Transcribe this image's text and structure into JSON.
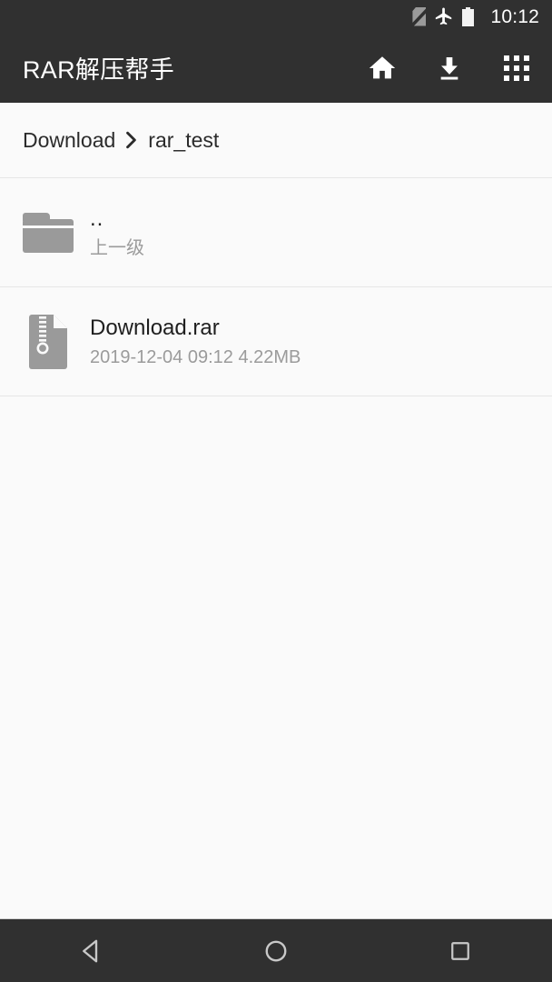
{
  "statusbar": {
    "time": "10:12",
    "icons": [
      "no-sim-icon",
      "airplane-mode-icon",
      "battery-icon"
    ]
  },
  "toolbar": {
    "title": "RAR解压帮手",
    "actions": [
      {
        "name": "home-icon",
        "label": "Home"
      },
      {
        "name": "download-icon",
        "label": "Download"
      },
      {
        "name": "apps-grid-icon",
        "label": "Apps"
      }
    ]
  },
  "breadcrumb": {
    "root": "Download",
    "separator": "chevron-right-icon",
    "current": "rar_test"
  },
  "list": {
    "items": [
      {
        "icon": "folder-icon",
        "title": "..",
        "subtitle": "上一级"
      },
      {
        "icon": "archive-file-icon",
        "title": "Download.rar",
        "subtitle": "2019-12-04 09:12  4.22MB",
        "date": "2019-12-04 09:12",
        "size": "4.22MB"
      }
    ]
  },
  "navbar": {
    "buttons": [
      {
        "name": "back-button",
        "label": "Back"
      },
      {
        "name": "home-button",
        "label": "Home"
      },
      {
        "name": "recents-button",
        "label": "Recents"
      }
    ]
  },
  "colors": {
    "toolbar_bg": "#303030",
    "page_bg": "#fafafa",
    "icon_gray": "#9a9a9a",
    "title_text": "#1f1f1f",
    "sub_text": "#9b9b9b",
    "divider": "#e6e6e6"
  }
}
